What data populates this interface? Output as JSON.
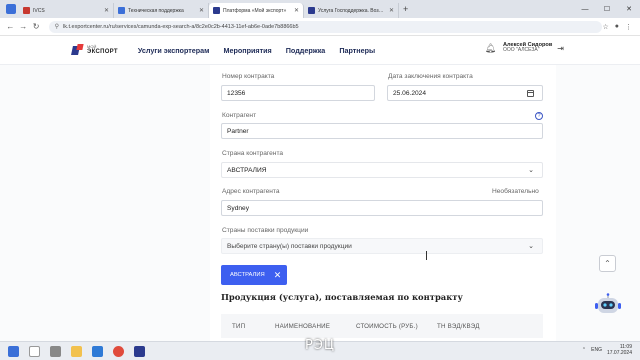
{
  "browser": {
    "tabs": [
      {
        "title": "IVCS",
        "color": "#c7382f",
        "active": false
      },
      {
        "title": "Техническая поддержка",
        "color": "#3b6fd8",
        "active": false
      },
      {
        "title": "Платформа «Мой экспорт»",
        "color": "#2b3a8e",
        "active": true
      },
      {
        "title": "Услуга Господдержка. Возме...",
        "color": "#2b3a8e",
        "active": false
      }
    ],
    "url": "lk.t.exportcenter.ru/ru/services/camunda-exp-search-a/8c2e0c2b-4413-11ef-ab6e-0ade7b8866b5"
  },
  "header": {
    "logo_top": "МОЙ",
    "logo_bottom": "ЭКСПОРТ",
    "nav": [
      "Услуги экспортерам",
      "Мероприятия",
      "Поддержка",
      "Партнеры"
    ],
    "user_name": "Алексей Сидоров",
    "user_org": "ООО \"АЛСЕЗА\""
  },
  "form": {
    "contract_number_label": "Номер контракта",
    "contract_number_value": "12356",
    "contract_date_label": "Дата заключения контракта",
    "contract_date_value": "25.06.2024",
    "counterparty_label": "Контрагент",
    "counterparty_value": "Partner",
    "counterparty_country_label": "Страна контрагента",
    "counterparty_country_value": "АВСТРАЛИЯ",
    "counterparty_address_label": "Адрес контрагента",
    "optional_label": "Необязательно",
    "counterparty_address_value": "Sydney",
    "supply_countries_label": "Страны поставки продукции",
    "supply_countries_placeholder": "Выберите страну(ы) поставки продукции",
    "selected_chip": "АВСТРАЛИЯ"
  },
  "products": {
    "title": "Продукция (услуга), поставляемая по контракту",
    "columns": [
      "ТИП",
      "НАИМЕНОВАНИЕ",
      "СТОИМОСТЬ (РУБ.)",
      "ТН ВЭД/КВЭД"
    ]
  },
  "taskbar": {
    "caption": "РЭЦ",
    "lang": "ENG",
    "time": "11:09",
    "date": "17.07.2024"
  }
}
